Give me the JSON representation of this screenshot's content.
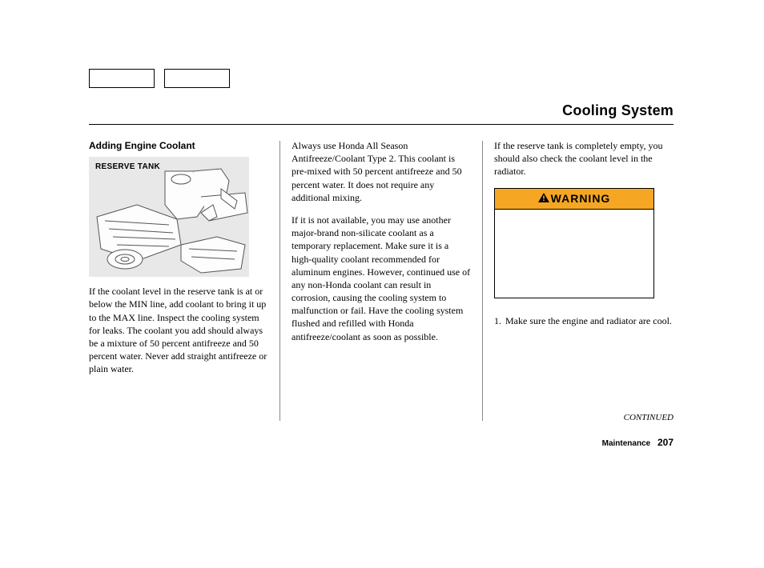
{
  "page_title": "Cooling System",
  "col1": {
    "subhead": "Adding Engine Coolant",
    "figure_label": "RESERVE TANK",
    "para1": "If the coolant level in the reserve tank is at or below the MIN line, add coolant to bring it up to the MAX line. Inspect the cooling system for leaks. The coolant you add should always be a mixture of 50 percent antifreeze and 50 percent water. Never add straight antifreeze or plain water."
  },
  "col2": {
    "para1": "Always use Honda All Season Antifreeze/Coolant Type 2. This coolant is pre-mixed with 50 percent antifreeze and 50 percent water. It does not require any additional mixing.",
    "para2": "If it is not available, you may use another major-brand non-silicate coolant as a temporary replacement. Make sure it is a high-quality coolant recommended for aluminum engines. However, continued use of any non-Honda coolant can result in corrosion, causing the cooling system to malfunction or fail. Have the cooling system flushed and refilled with Honda antifreeze/coolant as soon as possible."
  },
  "col3": {
    "para1": "If the reserve tank is completely empty, you should also check the coolant level in the radiator.",
    "warning_label": "WARNING",
    "step1_num": "1.",
    "step1_text": "Make sure the engine and radiator are cool."
  },
  "continued": "CONTINUED",
  "footer_section": "Maintenance",
  "footer_page": "207"
}
